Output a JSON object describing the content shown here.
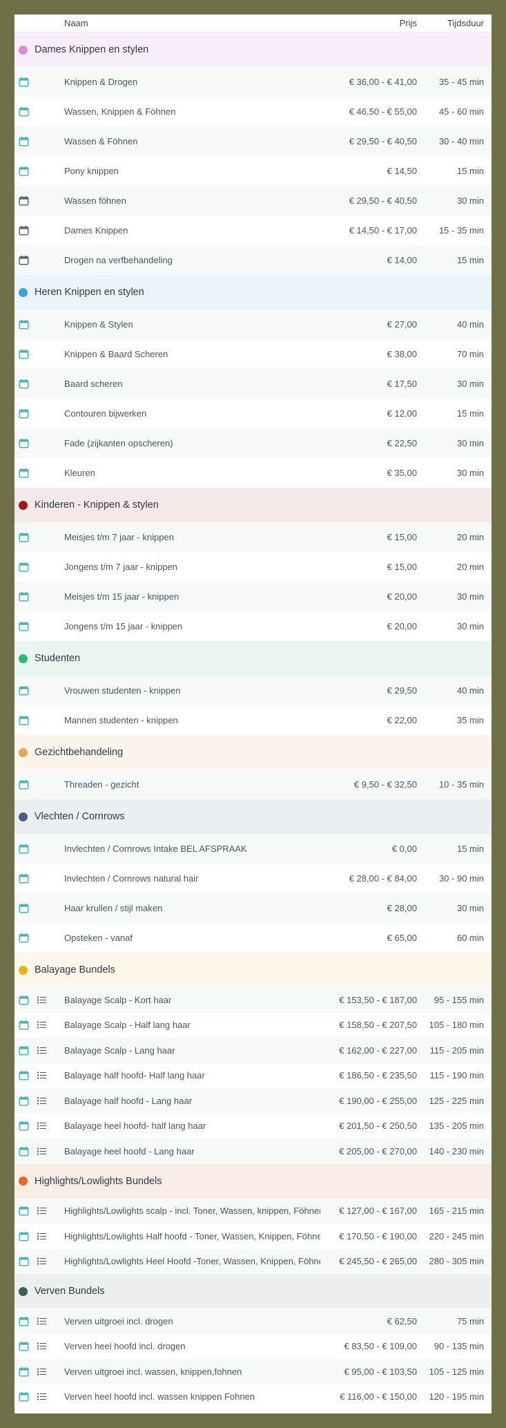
{
  "header": {
    "name_label": "Naam",
    "price_label": "Prijs",
    "duration_label": "Tijdsduur"
  },
  "colors": {
    "calendar_accent": "#4db6ac",
    "calendar_dark": "#5b6670",
    "list_icon": "#4a5560"
  },
  "categories": [
    {
      "name": "Dames Knippen en stylen",
      "dot_color": "#d98bd3",
      "bg": "#f7eefa",
      "services": [
        {
          "name": "Knippen & Drogen",
          "price": "€ 36,00 - € 41,00",
          "duration": "35 - 45 min",
          "icon": "calendar-icon"
        },
        {
          "name": "Wassen, Knippen & Föhnen",
          "price": "€ 46,50 - € 55,00",
          "duration": "45 - 60 min",
          "icon": "calendar-icon"
        },
        {
          "name": "Wassen & Föhnen",
          "price": "€ 29,50 - € 40,50",
          "duration": "30 - 40 min",
          "icon": "calendar-icon"
        },
        {
          "name": "Pony knippen",
          "price": "€ 14,50",
          "duration": "15 min",
          "icon": "calendar-icon"
        },
        {
          "name": "Wassen föhnen",
          "price": "€ 29,50 - € 40,50",
          "duration": "30 min",
          "icon": "calendar-icon-dark"
        },
        {
          "name": "Dames Knippen",
          "price": "€ 14,50 - € 17,00",
          "duration": "15 - 35 min",
          "icon": "calendar-icon-dark"
        },
        {
          "name": "Drogen na verfbehandeling",
          "price": "€ 14,00",
          "duration": "15 min",
          "icon": "calendar-icon-dark"
        }
      ]
    },
    {
      "name": "Heren Knippen en stylen",
      "dot_color": "#3fa3d9",
      "bg": "#e9f4fb",
      "services": [
        {
          "name": "Knippen & Stylen",
          "price": "€ 27,00",
          "duration": "40 min",
          "icon": "calendar-icon"
        },
        {
          "name": "Knippen & Baard Scheren",
          "price": "€ 38,00",
          "duration": "70 min",
          "icon": "calendar-icon"
        },
        {
          "name": "Baard scheren",
          "price": "€ 17,50",
          "duration": "30 min",
          "icon": "calendar-icon"
        },
        {
          "name": "Contouren bijwerken",
          "price": "€ 12,00",
          "duration": "15 min",
          "icon": "calendar-icon"
        },
        {
          "name": "Fade (zijkanten opscheren)",
          "price": "€ 22,50",
          "duration": "30 min",
          "icon": "calendar-icon"
        },
        {
          "name": "Kleuren",
          "price": "€ 35,00",
          "duration": "30 min",
          "icon": "calendar-icon"
        }
      ]
    },
    {
      "name": "Kinderen - Knippen & stylen",
      "dot_color": "#9e1a1a",
      "bg": "#f5e8e8",
      "services": [
        {
          "name": "Meisjes t/m 7 jaar - knippen",
          "price": "€ 15,00",
          "duration": "20 min",
          "icon": "calendar-icon"
        },
        {
          "name": "Jongens t/m 7 jaar - knippen",
          "price": "€ 15,00",
          "duration": "20 min",
          "icon": "calendar-icon"
        },
        {
          "name": "Meisjes t/m 15 jaar - knippen",
          "price": "€ 20,00",
          "duration": "30 min",
          "icon": "calendar-icon"
        },
        {
          "name": "Jongens t/m 15 jaar - knippen",
          "price": "€ 20,00",
          "duration": "30 min",
          "icon": "calendar-icon"
        }
      ]
    },
    {
      "name": "Studenten",
      "dot_color": "#2eb872",
      "bg": "#e8f6ef",
      "services": [
        {
          "name": "Vrouwen studenten - knippen",
          "price": "€ 29,50",
          "duration": "40 min",
          "icon": "calendar-icon"
        },
        {
          "name": "Mannen studenten - knippen",
          "price": "€ 22,00",
          "duration": "35 min",
          "icon": "calendar-icon"
        }
      ]
    },
    {
      "name": "Gezichtbehandeling",
      "dot_color": "#e0a85a",
      "bg": "#fcf3ea",
      "services": [
        {
          "name": "Threaden - gezicht",
          "price": "€ 9,50 - € 32,50",
          "duration": "10 - 35 min",
          "icon": "calendar-icon"
        }
      ]
    },
    {
      "name": "Vlechten / Cornrows",
      "dot_color": "#4a5f85",
      "bg": "#eceff2",
      "services": [
        {
          "name": "Invlechten / Cornrows Intake BEL AFSPRAAK",
          "price": "€ 0,00",
          "duration": "15 min",
          "icon": "calendar-icon"
        },
        {
          "name": "Invlechten / Cornrows natural hair",
          "price": "€ 28,00 - € 84,00",
          "duration": "30 - 90 min",
          "icon": "calendar-icon"
        },
        {
          "name": "Haar krullen / stijl maken",
          "price": "€ 28,00",
          "duration": "30 min",
          "icon": "calendar-icon"
        },
        {
          "name": "Opsteken - vanaf",
          "price": "€ 65,00",
          "duration": "60 min",
          "icon": "calendar-icon"
        }
      ]
    },
    {
      "name": "Balayage Bundels",
      "dot_color": "#e3b21c",
      "bg": "#fdf7e9",
      "bundle": true,
      "services": [
        {
          "name": "Balayage Scalp - Kort haar",
          "price": "€ 153,50 - € 187,00",
          "duration": "95 - 155 min",
          "icon": "calendar-icon"
        },
        {
          "name": "Balayage Scalp - Half lang haar",
          "price": "€ 158,50 - € 207,50",
          "duration": "105 - 180 min",
          "icon": "calendar-icon"
        },
        {
          "name": "Balayage Scalp - Lang haar",
          "price": "€ 162,00 - € 227,00",
          "duration": "115 - 205 min",
          "icon": "calendar-icon"
        },
        {
          "name": "Balayage half hoofd- Half lang haar",
          "price": "€ 186,50 - € 235,50",
          "duration": "115 - 190 min",
          "icon": "calendar-icon"
        },
        {
          "name": "Balayage half hoofd - Lang haar",
          "price": "€ 190,00 - € 255,00",
          "duration": "125 - 225 min",
          "icon": "calendar-icon"
        },
        {
          "name": "Balayage heel hoofd- half lang haar",
          "price": "€ 201,50 - € 250,50",
          "duration": "135 - 205 min",
          "icon": "calendar-icon"
        },
        {
          "name": "Balayage heel hoofd - Lang haar",
          "price": "€ 205,00 - € 270,00",
          "duration": "140 - 230 min",
          "icon": "calendar-icon"
        }
      ]
    },
    {
      "name": "Highlights/Lowlights Bundels",
      "dot_color": "#e06a2a",
      "bg": "#f9ede6",
      "bundle": true,
      "services": [
        {
          "name": "Highlights/Lowlights scalp - incl. Toner, Wassen, knippen, Föhnen",
          "price": "€ 127,00 - € 167,00",
          "duration": "165 - 215 min",
          "icon": "calendar-icon"
        },
        {
          "name": "Highlights/Lowlights Half hoofd - Toner, Wassen, Knippen, Föhnen",
          "price": "€ 170,50 - € 190,00",
          "duration": "220 - 245 min",
          "icon": "calendar-icon"
        },
        {
          "name": "Highlights/Lowlights Heel Hoofd -Toner, Wassen, Knippen, Föhnen",
          "price": "€ 245,50 - € 265,00",
          "duration": "280 - 305 min",
          "icon": "calendar-icon"
        }
      ]
    },
    {
      "name": "Verven Bundels",
      "dot_color": "#3e6152",
      "bg": "#ecefee",
      "bundle": true,
      "services": [
        {
          "name": "Verven uitgroei incl. drogen",
          "price": "€ 62,50",
          "duration": "75 min",
          "icon": "calendar-icon"
        },
        {
          "name": "Verven heel hoofd incl. drogen",
          "price": "€ 83,50 - € 109,00",
          "duration": "90 - 135 min",
          "icon": "calendar-icon"
        },
        {
          "name": "Verven uitgroei incl. wassen, knippen,fohnen",
          "price": "€ 95,00 - € 103,50",
          "duration": "105 - 125 min",
          "icon": "calendar-icon"
        },
        {
          "name": "Verven heel hoofd incl. wassen knippen Fohnen",
          "price": "€ 116,00 - € 150,00",
          "duration": "120 - 195 min",
          "icon": "calendar-icon"
        }
      ]
    }
  ]
}
